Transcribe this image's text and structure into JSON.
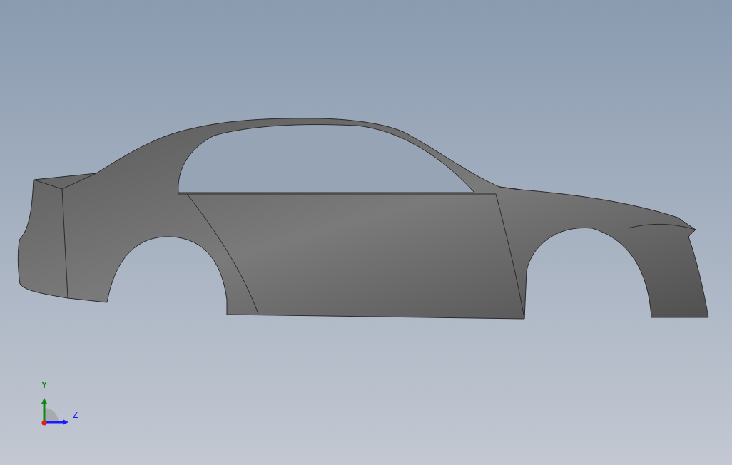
{
  "triad": {
    "axes": [
      {
        "label": "Y",
        "color": "#0d8a0d"
      },
      {
        "label": "Z",
        "color": "#1a1aff"
      }
    ]
  }
}
